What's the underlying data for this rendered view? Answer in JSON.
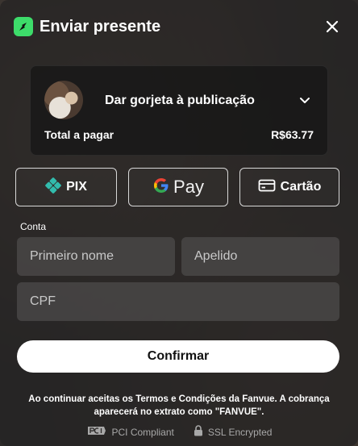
{
  "header": {
    "title": "Enviar presente"
  },
  "tip": {
    "label": "Dar gorjeta à publicação",
    "total_label": "Total a pagar",
    "total_value": "R$63.77"
  },
  "payment_methods": [
    {
      "label": "PIX",
      "icon": "pix-icon"
    },
    {
      "label": "Pay",
      "icon": "google-g-icon"
    },
    {
      "label": "Cartão",
      "icon": "credit-card-icon"
    }
  ],
  "account": {
    "section_label": "Conta",
    "first_name_placeholder": "Primeiro nome",
    "last_name_placeholder": "Apelido",
    "cpf_placeholder": "CPF"
  },
  "confirm_label": "Confirmar",
  "terms_text": "Ao continuar aceitas os Termos e Condições da Fanvue. A cobrança aparecerá no extrato como \"FANVUE\".",
  "badges": [
    {
      "label": "PCI Compliant",
      "icon": "pci-icon"
    },
    {
      "label": "SSL Encrypted",
      "icon": "lock-icon"
    }
  ],
  "colors": {
    "brand": "#3ddc6a",
    "pix": "#32bcad"
  }
}
